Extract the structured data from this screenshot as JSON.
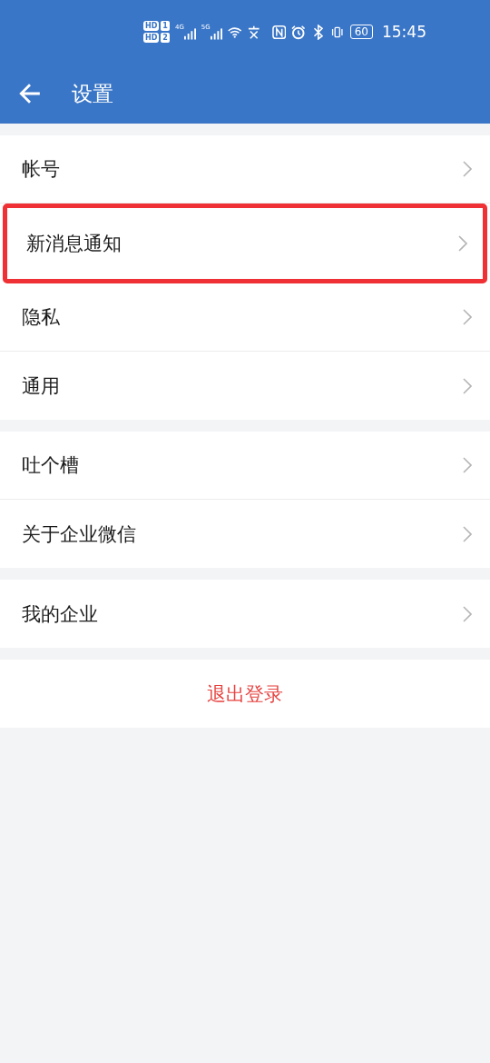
{
  "status_bar": {
    "sim_labels": [
      {
        "hd": "HD",
        "slot": "1"
      },
      {
        "hd": "HD",
        "slot": "2"
      }
    ],
    "networks": [
      "4G",
      "5G"
    ],
    "battery": "60",
    "time": "15:45"
  },
  "header": {
    "title": "设置"
  },
  "groups": [
    {
      "items": [
        {
          "label": "帐号",
          "highlighted": false
        },
        {
          "label": "新消息通知",
          "highlighted": true
        },
        {
          "label": "隐私",
          "highlighted": false
        },
        {
          "label": "通用",
          "highlighted": false
        }
      ]
    },
    {
      "items": [
        {
          "label": "吐个槽",
          "highlighted": false
        },
        {
          "label": "关于企业微信",
          "highlighted": false
        }
      ]
    },
    {
      "items": [
        {
          "label": "我的企业",
          "highlighted": false
        }
      ]
    }
  ],
  "logout": {
    "label": "退出登录"
  }
}
